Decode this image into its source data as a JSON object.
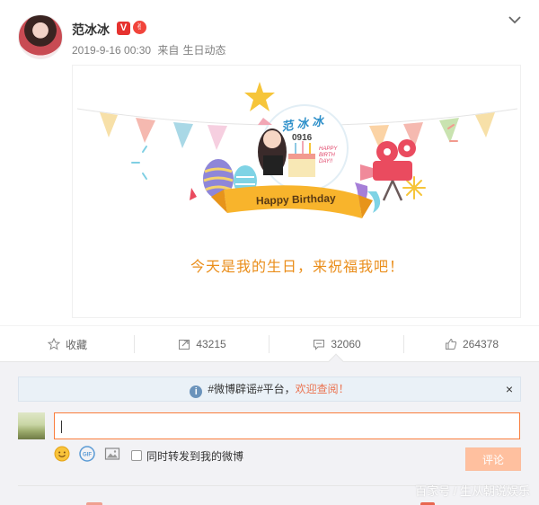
{
  "post": {
    "username": "范冰冰",
    "verified_mark": "V",
    "medal_mark": "✌",
    "timestamp": "2019-9-16 00:30",
    "source_prefix": "来自",
    "source": "生日动态",
    "card": {
      "name_badge": "范冰冰",
      "date_badge": "0916",
      "banner": "Happy Birthday",
      "cake_sign": "HAPPY BIRTH DAY!!",
      "text": "今天是我的生日，来祝福我吧！"
    }
  },
  "actions": {
    "favorite_label": "收藏",
    "repost_count": "43215",
    "comment_count": "32060",
    "like_count": "264378"
  },
  "comment_box": {
    "notice_prefix": "#微博辟谣#平台，",
    "notice_link": "欢迎查阅！",
    "notice_close": "×",
    "input_value": "",
    "repost_label": "同时转发到我的微博",
    "submit_label": "评论"
  },
  "watermark": "百家号 / 生从朝说娱乐",
  "colors": {
    "accent": "#fa7d3c",
    "submit_disabled": "#ffc09f",
    "card_text": "#ea8e1b",
    "notice_bg": "#eaf1f7",
    "link": "#eb7350"
  },
  "icons": [
    "avatar",
    "verified-badge",
    "medal-icon",
    "chevron-down-icon",
    "star-icon",
    "repost-icon",
    "comment-icon",
    "like-icon",
    "info-icon",
    "close-icon",
    "emoji-icon",
    "gif-icon",
    "image-icon"
  ]
}
